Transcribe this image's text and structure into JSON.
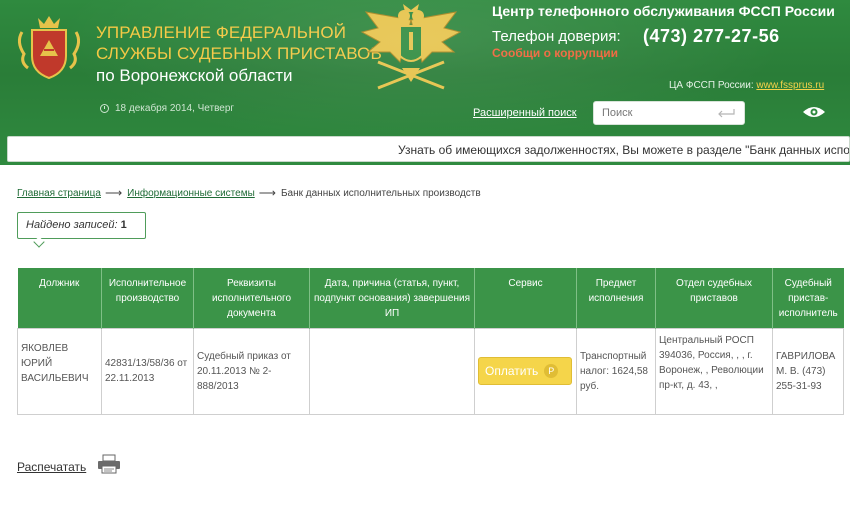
{
  "header": {
    "org_title_line1": "УПРАВЛЕНИЕ ФЕДЕРАЛЬНОЙ",
    "org_title_line2": "СЛУЖБЫ СУДЕБНЫХ ПРИСТАВОВ",
    "org_subtitle": "по Воронежской области",
    "date": "18 декабря 2014, Четверг",
    "hotline_title": "Центр телефонного обслуживания ФССП России",
    "trust_label": "Телефон доверия:",
    "trust_phone": "(473) 277-27-56",
    "corruption_link": "Сообщи о коррупции",
    "ca_label": "ЦА ФССП России:",
    "ca_link": "www.fssprus.ru",
    "advanced_search": "Расширенный поиск",
    "search_placeholder": "Поиск",
    "ticker": "Узнать об имеющихся задолженностях, Вы можете в разделе \"Банк данных исполнительных производств\""
  },
  "breadcrumb": {
    "home": "Главная страница",
    "systems": "Информационные системы",
    "current": "Банк данных исполнительных производств"
  },
  "found": {
    "label": "Найдено записей:",
    "count": "1"
  },
  "table": {
    "headers": [
      "Должник",
      "Исполнительное производство",
      "Реквизиты исполнительного документа",
      "Дата, причина (статья, пункт, подпункт основания) завершения ИП",
      "Сервис",
      "Предмет исполнения",
      "Отдел судебных приставов",
      "Судебный пристав-исполнитель"
    ],
    "row": {
      "debtor": "ЯКОВЛЕВ ЮРИЙ ВАСИЛЬЕВИЧ",
      "proceeding": "42831/13/58/36 от 22.11.2013",
      "document": "Судебный приказ от 20.11.2013 № 2-888/2013",
      "completion": "",
      "pay_label": "Оплатить",
      "pay_symbol": "Р",
      "subject": "Транспортный налог: 1624,58 руб.",
      "department": "Центральный РОСП 394036, Россия, , , г. Воронеж, , Революции пр-кт, д. 43, ,",
      "bailiff": "ГАВРИЛОВА М. В. (473) 255-31-93"
    }
  },
  "print_label": "Распечатать",
  "colors": {
    "header_green": "#2f8a3f",
    "table_header": "#3b9448",
    "gold": "#f5c842",
    "pay_button": "#f5d54a"
  },
  "icons": [
    "coat-of-arms-icon",
    "eagle-emblem-icon",
    "clock-icon",
    "enter-icon",
    "eye-icon",
    "printer-icon"
  ]
}
